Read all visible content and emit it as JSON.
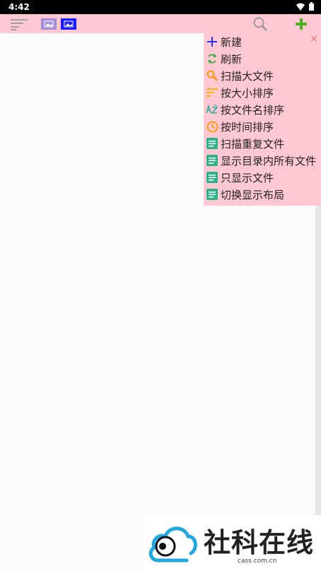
{
  "status_bar": {
    "time": "4:42"
  },
  "menu": {
    "close_glyph": "×",
    "items": [
      {
        "label": "新建",
        "icon": "plus-icon",
        "color": "#2b2bff"
      },
      {
        "label": "刷新",
        "icon": "refresh-icon",
        "color": "#3cb043"
      },
      {
        "label": "扫描大文件",
        "icon": "search-icon",
        "color": "#ff9900"
      },
      {
        "label": "按大小排序",
        "icon": "sort-lines-icon",
        "color": "#ffb300"
      },
      {
        "label": "按文件名排序",
        "icon": "az-sort-icon",
        "color": "#2bb3a0"
      },
      {
        "label": "按时间排序",
        "icon": "clock-icon",
        "color": "#ff9900"
      },
      {
        "label": "扫描重复文件",
        "icon": "document-icon",
        "color": "#2bb38a"
      },
      {
        "label": "显示目录内所有文件",
        "icon": "document-icon",
        "color": "#2bb38a"
      },
      {
        "label": "只显示文件",
        "icon": "document-icon",
        "color": "#2bb38a"
      },
      {
        "label": "切换显示布局",
        "icon": "document-icon",
        "color": "#2bb38a"
      }
    ]
  },
  "watermark": {
    "text": "社科在线",
    "url": "cass.com.cn"
  },
  "colors": {
    "toolbar": "#ffc8d2",
    "add_green": "#4caf20",
    "thumb_purple": "#a58ed6",
    "thumb_blue": "#1a1aff"
  }
}
